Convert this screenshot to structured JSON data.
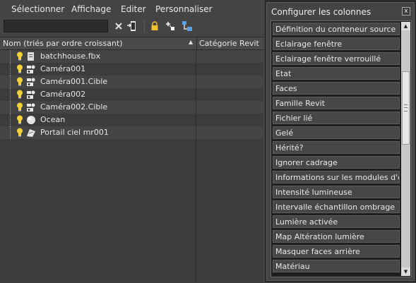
{
  "menu": [
    "Sélectionner",
    "Affichage",
    "Editer",
    "Personnaliser"
  ],
  "toolbar": {
    "search_value": "",
    "icons": [
      "clear-search-icon",
      "filter-selection-icon",
      "lock-icon",
      "add-link-icon",
      "hierarchy-icon"
    ]
  },
  "tree": {
    "columns": [
      "Nom (triés par ordre croissant)",
      "Catégorie Revit"
    ],
    "rows": [
      {
        "name": "batchhouse.fbx",
        "icon": "file-link-icon"
      },
      {
        "name": "Caméra001",
        "icon": "camera-icon"
      },
      {
        "name": "Caméra001.Cible",
        "icon": "camera-target-icon"
      },
      {
        "name": "Caméra002",
        "icon": "camera-icon"
      },
      {
        "name": "Caméra002.Cible",
        "icon": "camera-target-icon"
      },
      {
        "name": "Ocean",
        "icon": "sphere-icon"
      },
      {
        "name": "Portail ciel mr001",
        "icon": "sky-portal-icon"
      }
    ]
  },
  "panel": {
    "title": "Configurer les colonnes",
    "close_label": "x",
    "items": [
      "Définition du conteneur source",
      "Eclairage fenêtre",
      "Eclairage fenêtre verrouillé",
      "Etat",
      "Faces",
      "Famille Revit",
      "Fichier lié",
      "Gelé",
      "Hérité?",
      "Ignorer cadrage",
      "Informations sur les modules d'ex...",
      "Intensité lumineuse",
      "Intervalle échantillon ombrage",
      "Lumière activée",
      "Map Altération lumière",
      "Masquer faces arrière",
      "Matériau"
    ]
  },
  "colors": {
    "bulb": "#f2d23a",
    "background": "#444444",
    "list_bg": "#1f1f1f"
  }
}
